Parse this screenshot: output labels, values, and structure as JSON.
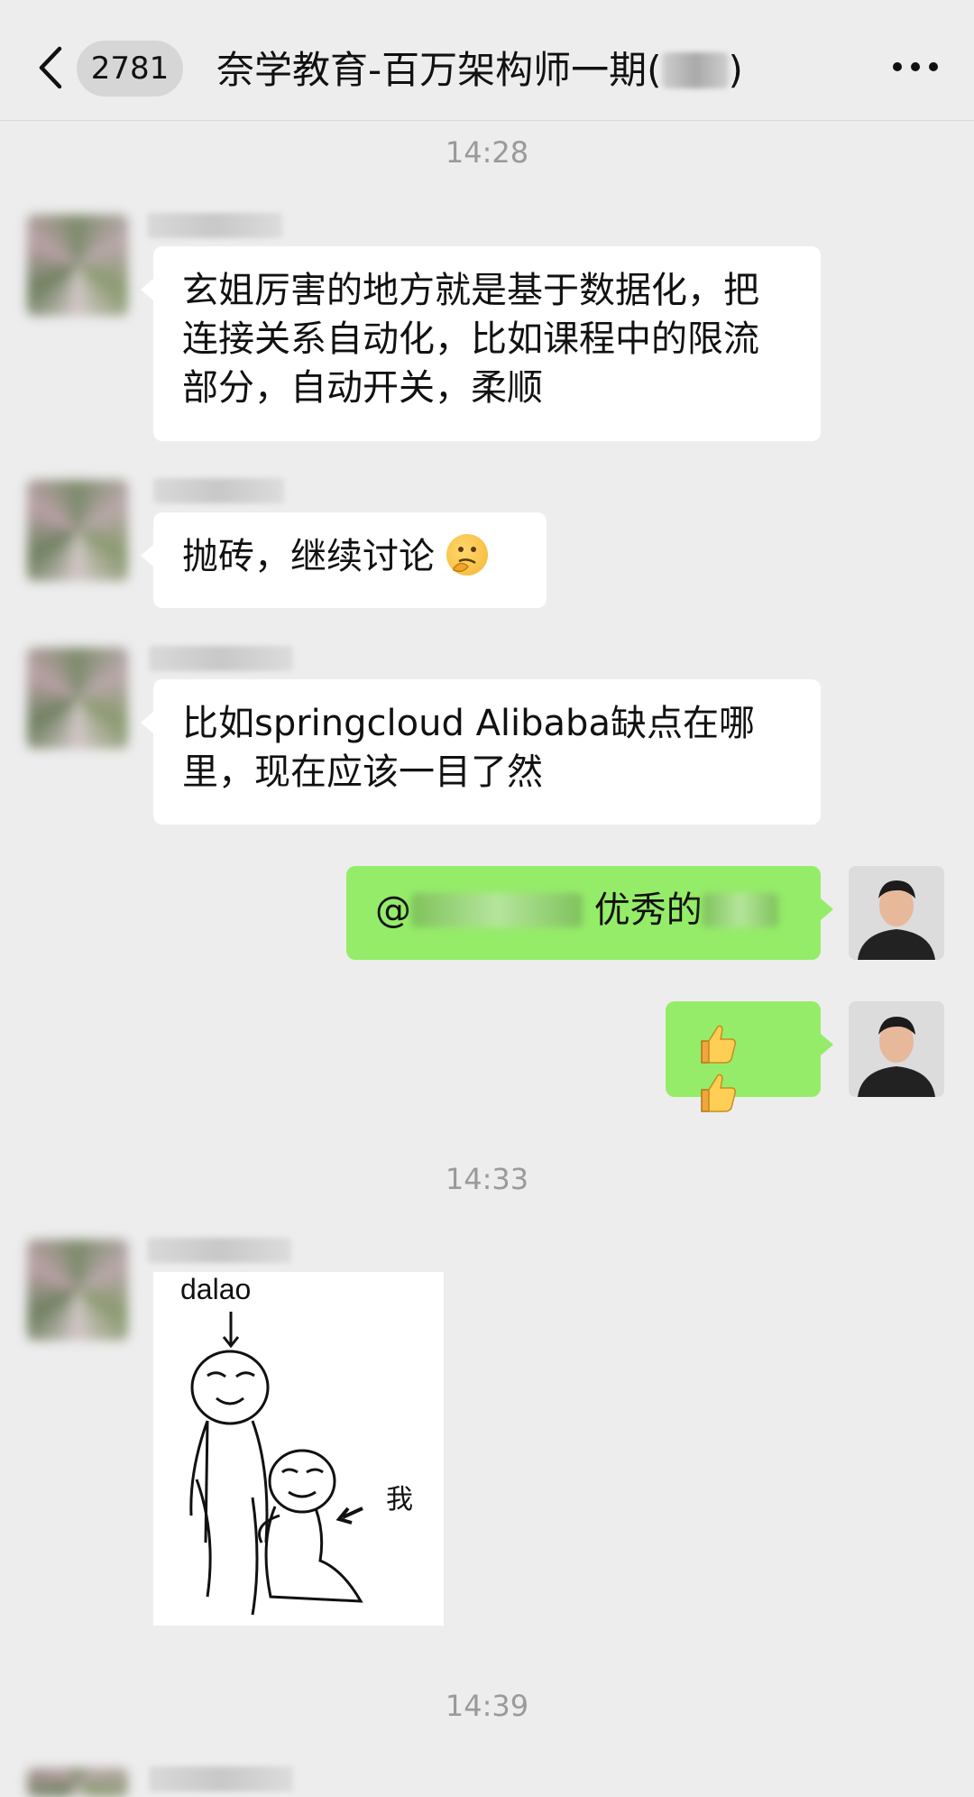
{
  "header": {
    "unread_count": "2781",
    "title": "奈学教育-百万架构师一期(",
    "title_end": ")"
  },
  "timestamps": [
    "14:28",
    "14:33",
    "14:39"
  ],
  "messages": [
    {
      "side": "left",
      "text": "玄姐厉害的地方就是基于数据化，把连接关系自动化，比如课程中的限流部分，自动开关，柔顺"
    },
    {
      "side": "left",
      "text": "抛砖，继续讨论"
    },
    {
      "side": "left",
      "text": "比如springcloud Alibaba缺点在哪里，现在应该一目了然"
    },
    {
      "side": "right",
      "text_prefix": "@",
      "text_mid": " 优秀的"
    },
    {
      "side": "right",
      "emoji": "thumbs-up thumbs-up"
    }
  ],
  "sticker": {
    "label_top": "dalao",
    "label_right": "我"
  },
  "colors": {
    "background": "#ededed",
    "bubble_left": "#ffffff",
    "bubble_right": "#95ec69"
  }
}
